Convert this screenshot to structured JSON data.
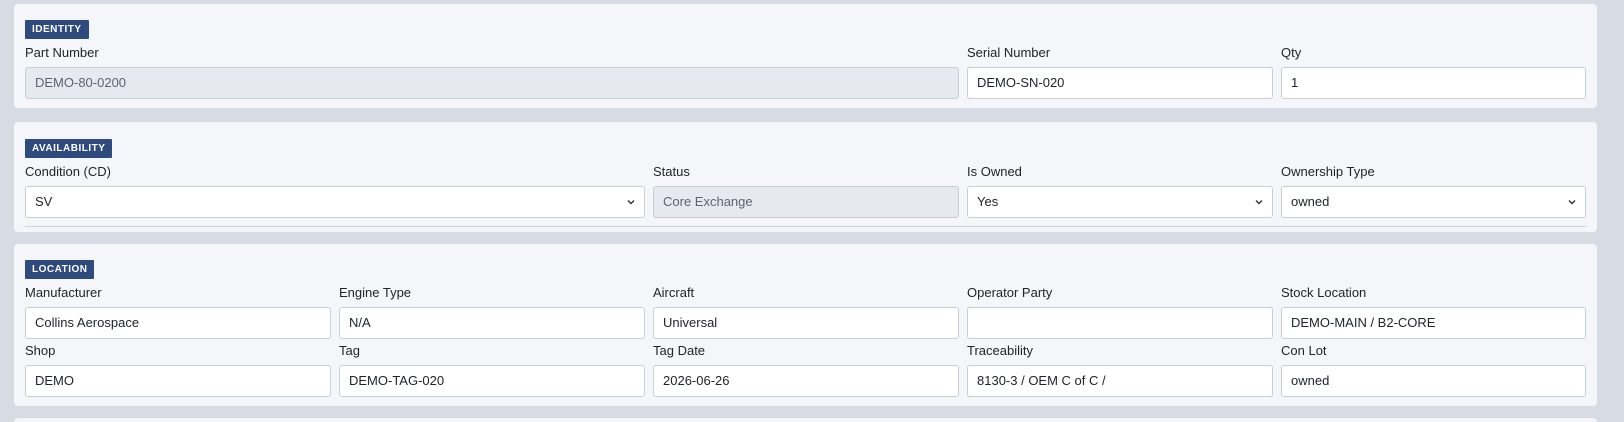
{
  "identity": {
    "badge": "IDENTITY",
    "part_number": {
      "label": "Part Number",
      "value": "DEMO-80-0200"
    },
    "serial_number": {
      "label": "Serial Number",
      "value": "DEMO-SN-020"
    },
    "qty": {
      "label": "Qty",
      "value": "1"
    }
  },
  "availability": {
    "badge": "AVAILABILITY",
    "condition": {
      "label": "Condition (CD)",
      "value": "SV"
    },
    "status": {
      "label": "Status",
      "value": "Core Exchange"
    },
    "is_owned": {
      "label": "Is Owned",
      "value": "Yes"
    },
    "ownership_type": {
      "label": "Ownership Type",
      "value": "owned"
    }
  },
  "location": {
    "badge": "LOCATION",
    "manufacturer": {
      "label": "Manufacturer",
      "value": "Collins Aerospace"
    },
    "engine_type": {
      "label": "Engine Type",
      "value": "N/A"
    },
    "aircraft": {
      "label": "Aircraft",
      "value": "Universal"
    },
    "operator_party": {
      "label": "Operator Party",
      "value": ""
    },
    "stock_location": {
      "label": "Stock Location",
      "value": "DEMO-MAIN / B2-CORE"
    },
    "shop": {
      "label": "Shop",
      "value": "DEMO"
    },
    "tag": {
      "label": "Tag",
      "value": "DEMO-TAG-020"
    },
    "tag_date": {
      "label": "Tag Date",
      "value": "2026-06-26"
    },
    "traceability": {
      "label": "Traceability",
      "value": "8130-3 / OEM C of C /"
    },
    "con_lot": {
      "label": "Con Lot",
      "value": "owned"
    }
  }
}
